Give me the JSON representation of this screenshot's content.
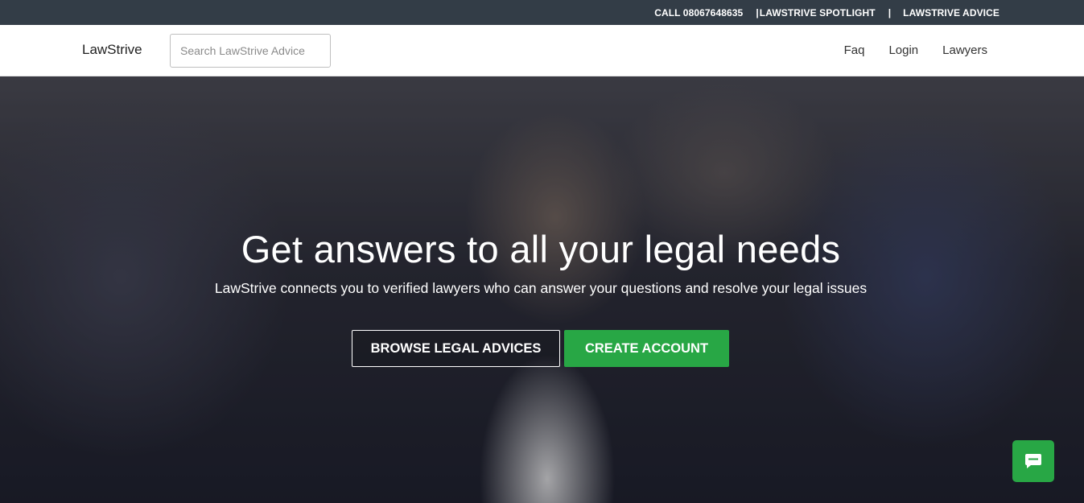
{
  "topbar": {
    "call": "CALL 08067648635",
    "sep1": "|",
    "spotlight": "LAWSTRIVE SPOTLIGHT",
    "sep2": "|",
    "advice": "LAWSTRIVE ADVICE",
    "background_color": "#333d47"
  },
  "navbar": {
    "brand": "LawStrive",
    "search_placeholder": "Search LawStrive Advice",
    "search_value": "",
    "links": [
      "Faq",
      "Login",
      "Lawyers"
    ]
  },
  "hero": {
    "title": "Get answers to all your legal needs",
    "subtitle": "LawStrive connects you to verified lawyers who can answer your questions and resolve your legal issues",
    "browse_button": "BROWSE LEGAL ADVICES",
    "create_button": "CREATE ACCOUNT",
    "accent_color": "#28a745"
  },
  "chat_widget": {
    "icon": "chat-bubble-icon"
  }
}
